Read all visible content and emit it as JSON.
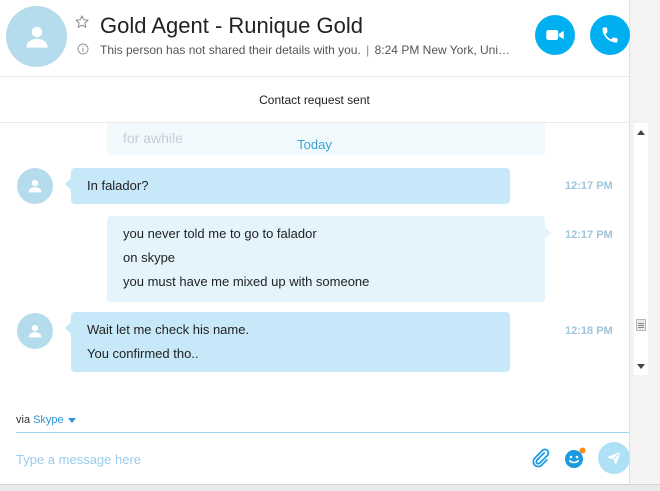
{
  "header": {
    "contact_name": "Gold Agent - Runique Gold",
    "status_message": "This person has not shared their details with you.",
    "separator": "|",
    "local_time": "8:24 PM New York, Unite..."
  },
  "request_status": "Contact request sent",
  "conversation": {
    "faded_text": "for awhile",
    "day_label": "Today",
    "messages": [
      {
        "direction": "incoming",
        "lines": [
          "In falador?"
        ],
        "time": "12:17 PM"
      },
      {
        "direction": "outgoing",
        "lines": [
          "you never told me to go to falador",
          "on skype",
          "you must have me mixed up with someone"
        ],
        "time": "12:17 PM"
      },
      {
        "direction": "incoming",
        "lines": [
          "Wait let me check his name.",
          "You confirmed tho.."
        ],
        "time": "12:18 PM"
      }
    ]
  },
  "compose": {
    "via_label": "via",
    "via_service": "Skype",
    "placeholder": "Type a message here"
  },
  "colors": {
    "accent": "#00aff0",
    "incoming_bubble": "#c7e8f8",
    "outgoing_bubble": "#e3f4fc",
    "timestamp": "#9fc5db"
  }
}
